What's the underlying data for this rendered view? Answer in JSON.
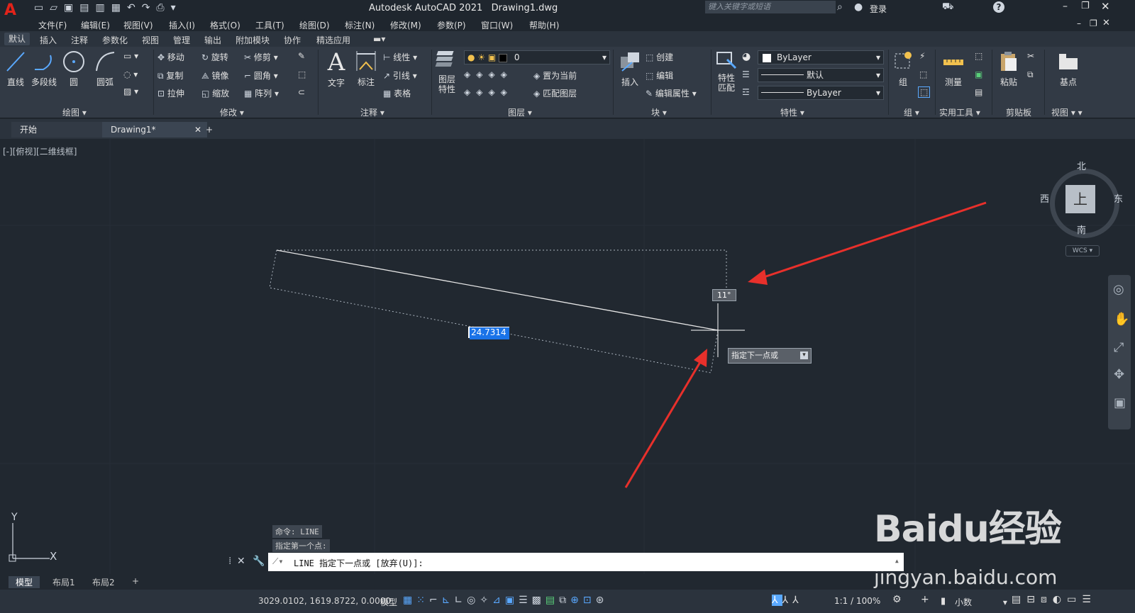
{
  "titlebar": {
    "app_title": "Autodesk AutoCAD 2021",
    "file": "Drawing1.dwg",
    "search_placeholder": "键入关键字或短语",
    "login": "登录"
  },
  "menus": [
    "文件(F)",
    "编辑(E)",
    "视图(V)",
    "插入(I)",
    "格式(O)",
    "工具(T)",
    "绘图(D)",
    "标注(N)",
    "修改(M)",
    "参数(P)",
    "窗口(W)",
    "帮助(H)"
  ],
  "ribbon_tabs": [
    "默认",
    "插入",
    "注释",
    "参数化",
    "视图",
    "管理",
    "输出",
    "附加模块",
    "协作",
    "精选应用"
  ],
  "draw_panel": {
    "title": "绘图",
    "tools": [
      "直线",
      "多段线",
      "圆",
      "圆弧"
    ]
  },
  "modify_panel": {
    "title": "修改",
    "tools": [
      "移动",
      "旋转",
      "修剪",
      "复制",
      "镜像",
      "圆角",
      "拉伸",
      "缩放",
      "阵列"
    ]
  },
  "annotate_panel": {
    "title": "注释",
    "big": [
      "文字",
      "标注"
    ],
    "small": [
      "线性",
      "引线",
      "表格"
    ]
  },
  "layers_panel": {
    "title": "图层",
    "big": "图层\n特性",
    "layer_value": "0",
    "actions": [
      "置为当前",
      "匹配图层"
    ]
  },
  "block_panel": {
    "title": "块",
    "big": "插入",
    "actions": [
      "创建",
      "编辑",
      "编辑属性"
    ]
  },
  "props_panel": {
    "title": "特性",
    "big": "特性\n匹配",
    "color": "ByLayer",
    "linetype": "默认",
    "lineweight": "ByLayer"
  },
  "group_panel": {
    "title": "组",
    "big": "组"
  },
  "utilities_panel": {
    "title": "实用工具",
    "big": "测量"
  },
  "clipboard_panel": {
    "title": "剪贴板",
    "big": "粘贴"
  },
  "view_panel": {
    "title": "视图",
    "big": "基点"
  },
  "doc_tabs": [
    "开始",
    "Drawing1*"
  ],
  "view_label": "[-][俯视][二维线框]",
  "viewcube": {
    "north": "北",
    "south": "南",
    "east": "东",
    "west": "西",
    "face": "上",
    "wcs": "WCS"
  },
  "drawing": {
    "angle": "11°",
    "length": "24.7314",
    "prompt": "指定下一点或"
  },
  "command": {
    "history": [
      "命令: LINE",
      "指定第一个点:"
    ],
    "current": "LINE 指定下一点或 [放弃(U)]:"
  },
  "ucs": {
    "x": "X",
    "y": "Y"
  },
  "layout_tabs": [
    "模型",
    "布局1",
    "布局2"
  ],
  "status": {
    "coords": "3029.0102, 1619.8722, 0.0000",
    "model": "模型",
    "scale": "1:1 / 100%",
    "units": "小数"
  },
  "watermark": {
    "brand": "Baidu经验",
    "url": "jingyan.baidu.com"
  },
  "colors": {
    "accent_red": "#e8302b",
    "background": "#212830",
    "ribbon": "#323a45"
  }
}
